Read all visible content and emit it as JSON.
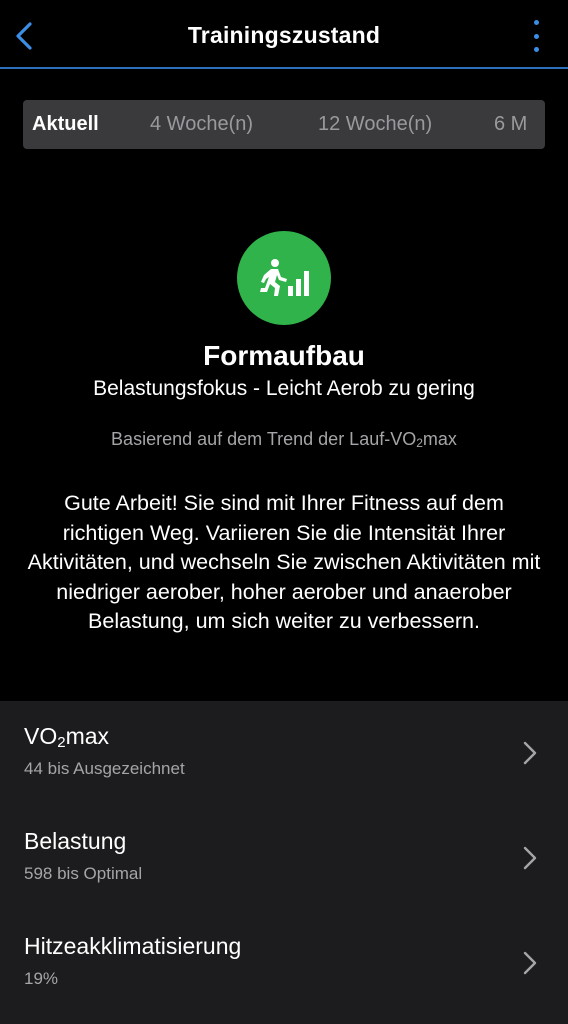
{
  "header": {
    "title": "Trainingszustand",
    "back_icon": "chevron-left-icon",
    "more_icon": "more-vertical-icon",
    "accent_color": "#3a8ee6"
  },
  "tabs": [
    {
      "label": "Aktuell",
      "active": true
    },
    {
      "label": "4 Woche(n)",
      "active": false
    },
    {
      "label": "12 Woche(n)",
      "active": false
    },
    {
      "label": "6 M",
      "active": false
    }
  ],
  "status": {
    "icon": "runner-progress-icon",
    "color": "#2fb34a",
    "title": "Formaufbau",
    "subtitle": "Belastungsfokus - Leicht Aerob zu gering",
    "trend_prefix": "Basierend auf dem Trend der Lauf-VO",
    "trend_sub": "2",
    "trend_suffix": "max",
    "message": "Gute Arbeit! Sie sind mit Ihrer Fitness auf dem richtigen Weg. Variieren Sie die Intensität Ihrer Aktivitäten, und wechseln Sie zwischen Aktivitäten mit niedriger aerober, hoher aerober und anaerober Belastung, um sich weiter zu verbessern."
  },
  "list": [
    {
      "label_prefix": "VO",
      "label_sub": "2",
      "label_suffix": "max",
      "value": "44 bis Ausgezeichnet"
    },
    {
      "label_prefix": "Belastung",
      "label_sub": "",
      "label_suffix": "",
      "value": "598 bis Optimal"
    },
    {
      "label_prefix": "Hitzeakklimatisierung",
      "label_sub": "",
      "label_suffix": "",
      "value": "19%"
    }
  ]
}
